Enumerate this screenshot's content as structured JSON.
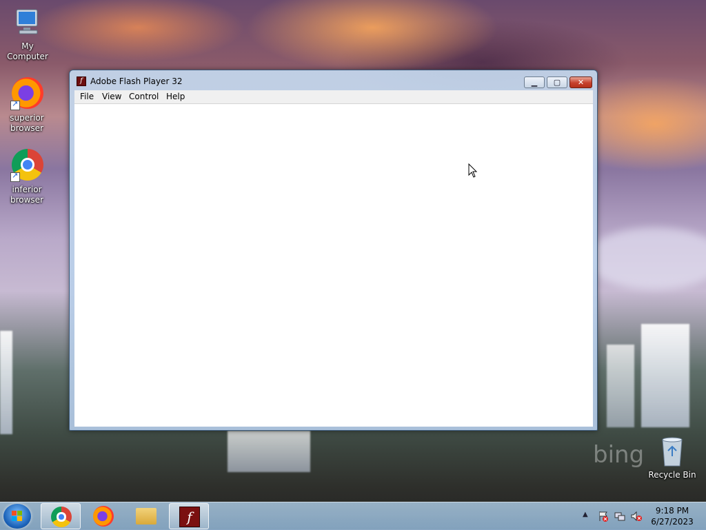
{
  "desktop": {
    "icons": [
      {
        "label": "My Computer",
        "icon": "computer-icon"
      },
      {
        "label": "superior browser",
        "icon": "firefox-icon"
      },
      {
        "label": "inferior browser",
        "icon": "chrome-icon"
      },
      {
        "label": "Recycle Bin",
        "icon": "recycle-bin-icon"
      }
    ],
    "wallpaper_watermark": "bing"
  },
  "window": {
    "title": "Adobe Flash Player 32",
    "icon": "flash-icon",
    "controls": {
      "minimize": "minimize-icon",
      "maximize": "maximize-icon",
      "close": "close-icon"
    },
    "menu": [
      "File",
      "View",
      "Control",
      "Help"
    ]
  },
  "taskbar": {
    "pinned": [
      {
        "name": "Google Chrome",
        "icon": "chrome-icon"
      },
      {
        "name": "Firefox",
        "icon": "firefox-icon"
      },
      {
        "name": "Windows Explorer",
        "icon": "folder-icon"
      },
      {
        "name": "Adobe Flash Player",
        "icon": "flash-icon",
        "active": true
      }
    ],
    "tray_icons": [
      "show-hidden-icons-icon",
      "action-center-icon",
      "network-icon",
      "volume-muted-icon"
    ],
    "clock": {
      "time": "9:18 PM",
      "date": "6/27/2023"
    }
  },
  "colors": {
    "close_button": "#c7412c",
    "flash_red": "#7b1010",
    "taskbar": "#a9c3dc"
  }
}
